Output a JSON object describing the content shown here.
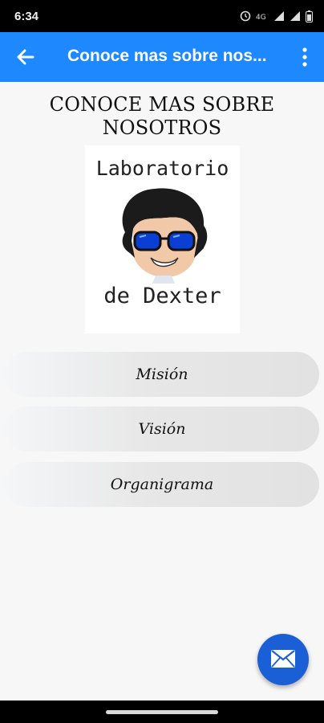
{
  "status_bar": {
    "time": "6:34",
    "icons": [
      "alarm-icon",
      "data-icon",
      "wifi-icon",
      "signal-icon",
      "battery-icon"
    ]
  },
  "app_bar": {
    "title": "Conoce mas sobre nos...",
    "back_icon": "arrow-left-icon",
    "menu_icon": "more-vert-icon",
    "color": "#1e88ff"
  },
  "main": {
    "heading": "CONOCE MAS SOBRE NOSOTROS",
    "logo": {
      "text_top": "Laboratorio",
      "text_bottom": "de Dexter"
    },
    "menu_items": [
      {
        "label": "Misión"
      },
      {
        "label": "Visión"
      },
      {
        "label": "Organigrama"
      }
    ]
  },
  "fab": {
    "icon": "mail-icon",
    "color": "#1a5fd6"
  }
}
